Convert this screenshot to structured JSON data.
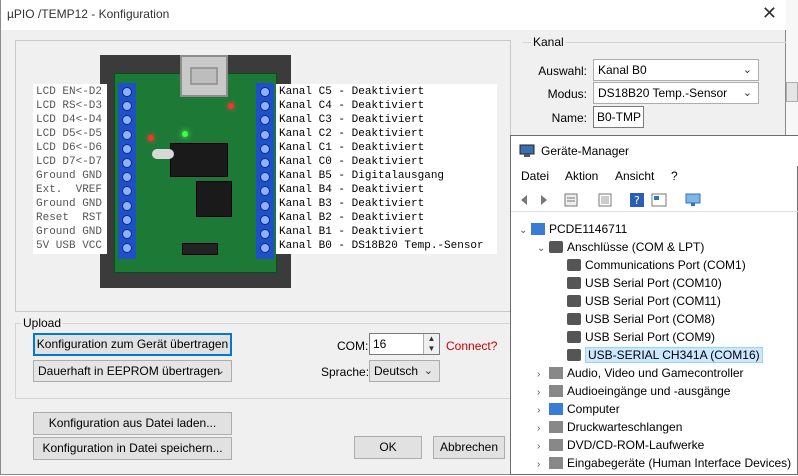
{
  "window": {
    "title": "µPIO /TEMP12 - Konfiguration",
    "close_glyph": "✕"
  },
  "pins_left": [
    "LCD EN<-D2",
    "LCD RS<-D3",
    "LCD D4<-D4",
    "LCD D5<-D5",
    "LCD D6<-D6",
    "LCD D7<-D7",
    "Ground GND",
    "Ext.  VREF",
    "Ground GND",
    "Reset  RST",
    "Ground GND",
    "5V USB VCC"
  ],
  "pins_right": [
    "Kanal C5 - Deaktiviert",
    "Kanal C4 - Deaktiviert",
    "Kanal C3 - Deaktiviert",
    "Kanal C2 - Deaktiviert",
    "Kanal C1 - Deaktiviert",
    "Kanal C0 - Deaktiviert",
    "Kanal B5 - Digitalausgang",
    "Kanal B4 - Deaktiviert",
    "Kanal B3 - Deaktiviert",
    "Kanal B2 - Deaktiviert",
    "Kanal B1 - Deaktiviert",
    "Kanal B0 - DS18B20 Temp.-Sensor"
  ],
  "kanal": {
    "legend": "Kanal",
    "auswahl_label": "Auswahl:",
    "auswahl_value": "Kanal B0",
    "modus_label": "Modus:",
    "modus_value": "DS18B20 Temp.-Sensor",
    "name_label": "Name:",
    "name_value": "B0-TMP"
  },
  "upload": {
    "legend": "Upload",
    "transfer_button": "Konfiguration zum Gerät übertragen",
    "eeprom_value": "Dauerhaft in EEPROM übertragen",
    "com_label": "COM:",
    "com_value": "16",
    "connect_link": "Connect?",
    "sprache_label": "Sprache:",
    "sprache_value": "Deutsch"
  },
  "buttons": {
    "load": "Konfiguration aus Datei laden...",
    "save": "Konfiguration in Datei speichern...",
    "ok": "OK",
    "cancel": "Abbrechen"
  },
  "device_manager": {
    "title": "Geräte-Manager",
    "menu": [
      "Datei",
      "Aktion",
      "Ansicht",
      "?"
    ],
    "tree": [
      {
        "label": "PCDE1146711",
        "level": 0,
        "expander": "⌄",
        "icon": "computer-icon"
      },
      {
        "label": "Anschlüsse (COM & LPT)",
        "level": 1,
        "expander": "⌄",
        "icon": "port-icon"
      },
      {
        "label": "Communications Port (COM1)",
        "level": 2,
        "expander": "",
        "icon": "port-icon"
      },
      {
        "label": "USB Serial Port (COM10)",
        "level": 2,
        "expander": "",
        "icon": "port-icon"
      },
      {
        "label": "USB Serial Port (COM11)",
        "level": 2,
        "expander": "",
        "icon": "port-icon"
      },
      {
        "label": "USB Serial Port (COM8)",
        "level": 2,
        "expander": "",
        "icon": "port-icon"
      },
      {
        "label": "USB Serial Port (COM9)",
        "level": 2,
        "expander": "",
        "icon": "port-icon"
      },
      {
        "label": "USB-SERIAL CH341A (COM16)",
        "level": 2,
        "expander": "",
        "icon": "port-icon",
        "selected": true
      },
      {
        "label": "Audio, Video und Gamecontroller",
        "level": 1,
        "expander": "›",
        "icon": "speaker-icon"
      },
      {
        "label": "Audioeingänge und -ausgänge",
        "level": 1,
        "expander": "›",
        "icon": "speaker-icon"
      },
      {
        "label": "Computer",
        "level": 1,
        "expander": "›",
        "icon": "monitor-icon"
      },
      {
        "label": "Druckwarteschlangen",
        "level": 1,
        "expander": "›",
        "icon": "printer-icon"
      },
      {
        "label": "DVD/CD-ROM-Laufwerke",
        "level": 1,
        "expander": "›",
        "icon": "disc-icon"
      },
      {
        "label": "Eingabegeräte (Human Interface Devices)",
        "level": 1,
        "expander": "›",
        "icon": "hid-icon"
      }
    ]
  }
}
